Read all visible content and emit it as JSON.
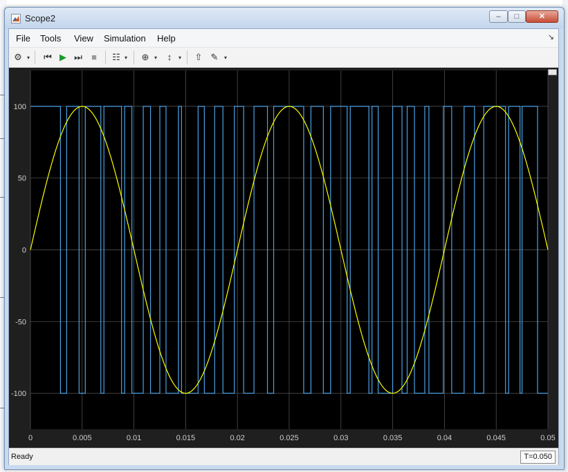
{
  "window": {
    "title": "Scope2",
    "minimize_glyph": "–",
    "maximize_glyph": "□",
    "close_glyph": "✕"
  },
  "menu": [
    "File",
    "Tools",
    "View",
    "Simulation",
    "Help"
  ],
  "menu_pin_glyph": "↘",
  "toolbar": [
    {
      "name": "configuration-properties-icon",
      "glyph": "⚙"
    },
    {
      "name": "step-back-icon",
      "glyph": "⏮"
    },
    {
      "name": "run-icon",
      "glyph": "▶"
    },
    {
      "name": "step-forward-icon",
      "glyph": "⏭"
    },
    {
      "name": "stop-icon",
      "glyph": "■"
    },
    {
      "name": "signal-selector-icon",
      "glyph": "☷"
    },
    {
      "name": "zoom-in-icon",
      "glyph": "⊕"
    },
    {
      "name": "scale-axes-icon",
      "glyph": "↕"
    },
    {
      "name": "highlight-block-icon",
      "glyph": "⇧"
    },
    {
      "name": "style-icon",
      "glyph": "✎"
    }
  ],
  "colors": {
    "background": "#000000",
    "axes_frame": "#1f1f1f",
    "grid": "#5a5a5a",
    "tick_label": "#cfcfcf",
    "pwm_series": "#4aa3e8",
    "sine_series": "#ffff00"
  },
  "chart_data": {
    "type": "line",
    "xlim": [
      0,
      0.05
    ],
    "ylim": [
      -125,
      125
    ],
    "x_ticks": [
      0,
      0.005,
      0.01,
      0.015,
      0.02,
      0.025,
      0.03,
      0.035,
      0.04,
      0.045,
      0.05
    ],
    "x_tick_labels": [
      "0",
      "0.005",
      "0.01",
      "0.015",
      "0.02",
      "0.025",
      "0.03",
      "0.035",
      "0.04",
      "0.045",
      "0.05"
    ],
    "y_ticks": [
      -100,
      -50,
      0,
      50,
      100
    ],
    "y_tick_labels": [
      "-100",
      "-50",
      "0",
      "50",
      "100"
    ],
    "grid": true,
    "series": [
      {
        "color": "#4aa3e8",
        "style": "step",
        "amplitude": 100,
        "transitions": [
          [
            0,
            100
          ],
          [
            0.0029,
            -100
          ],
          [
            0.0035,
            100
          ],
          [
            0.0047,
            -100
          ],
          [
            0.0053,
            100
          ],
          [
            0.0068,
            -100
          ],
          [
            0.0071,
            100
          ],
          [
            0.0088,
            -100
          ],
          [
            0.0091,
            100
          ],
          [
            0.0098,
            -100
          ],
          [
            0.0109,
            100
          ],
          [
            0.0116,
            -100
          ],
          [
            0.0125,
            100
          ],
          [
            0.0131,
            -100
          ],
          [
            0.0143,
            100
          ],
          [
            0.0146,
            -100
          ],
          [
            0.0162,
            100
          ],
          [
            0.0168,
            -100
          ],
          [
            0.0178,
            100
          ],
          [
            0.0186,
            -100
          ],
          [
            0.0197,
            100
          ],
          [
            0.0206,
            -100
          ],
          [
            0.0216,
            100
          ],
          [
            0.0229,
            -100
          ],
          [
            0.0235,
            100
          ],
          [
            0.0264,
            -100
          ],
          [
            0.0271,
            100
          ],
          [
            0.0283,
            -100
          ],
          [
            0.029,
            100
          ],
          [
            0.0306,
            -100
          ],
          [
            0.0309,
            100
          ],
          [
            0.0327,
            -100
          ],
          [
            0.033,
            100
          ],
          [
            0.0336,
            -100
          ],
          [
            0.035,
            100
          ],
          [
            0.0359,
            -100
          ],
          [
            0.0364,
            100
          ],
          [
            0.0371,
            -100
          ],
          [
            0.0381,
            100
          ],
          [
            0.0385,
            -100
          ],
          [
            0.0399,
            100
          ],
          [
            0.0407,
            -100
          ],
          [
            0.0419,
            100
          ],
          [
            0.0429,
            -100
          ],
          [
            0.0438,
            100
          ],
          [
            0.0459,
            -100
          ],
          [
            0.0462,
            100
          ],
          [
            0.0473,
            -100
          ],
          [
            0.0475,
            100
          ],
          [
            0.049,
            -100
          ],
          [
            0.05,
            -100
          ]
        ]
      },
      {
        "color": "#ffff00",
        "style": "sine",
        "amplitude": 100,
        "frequency_hz": 50,
        "phase": 0
      }
    ]
  },
  "status": {
    "text": "Ready",
    "time": "T=0.050"
  }
}
